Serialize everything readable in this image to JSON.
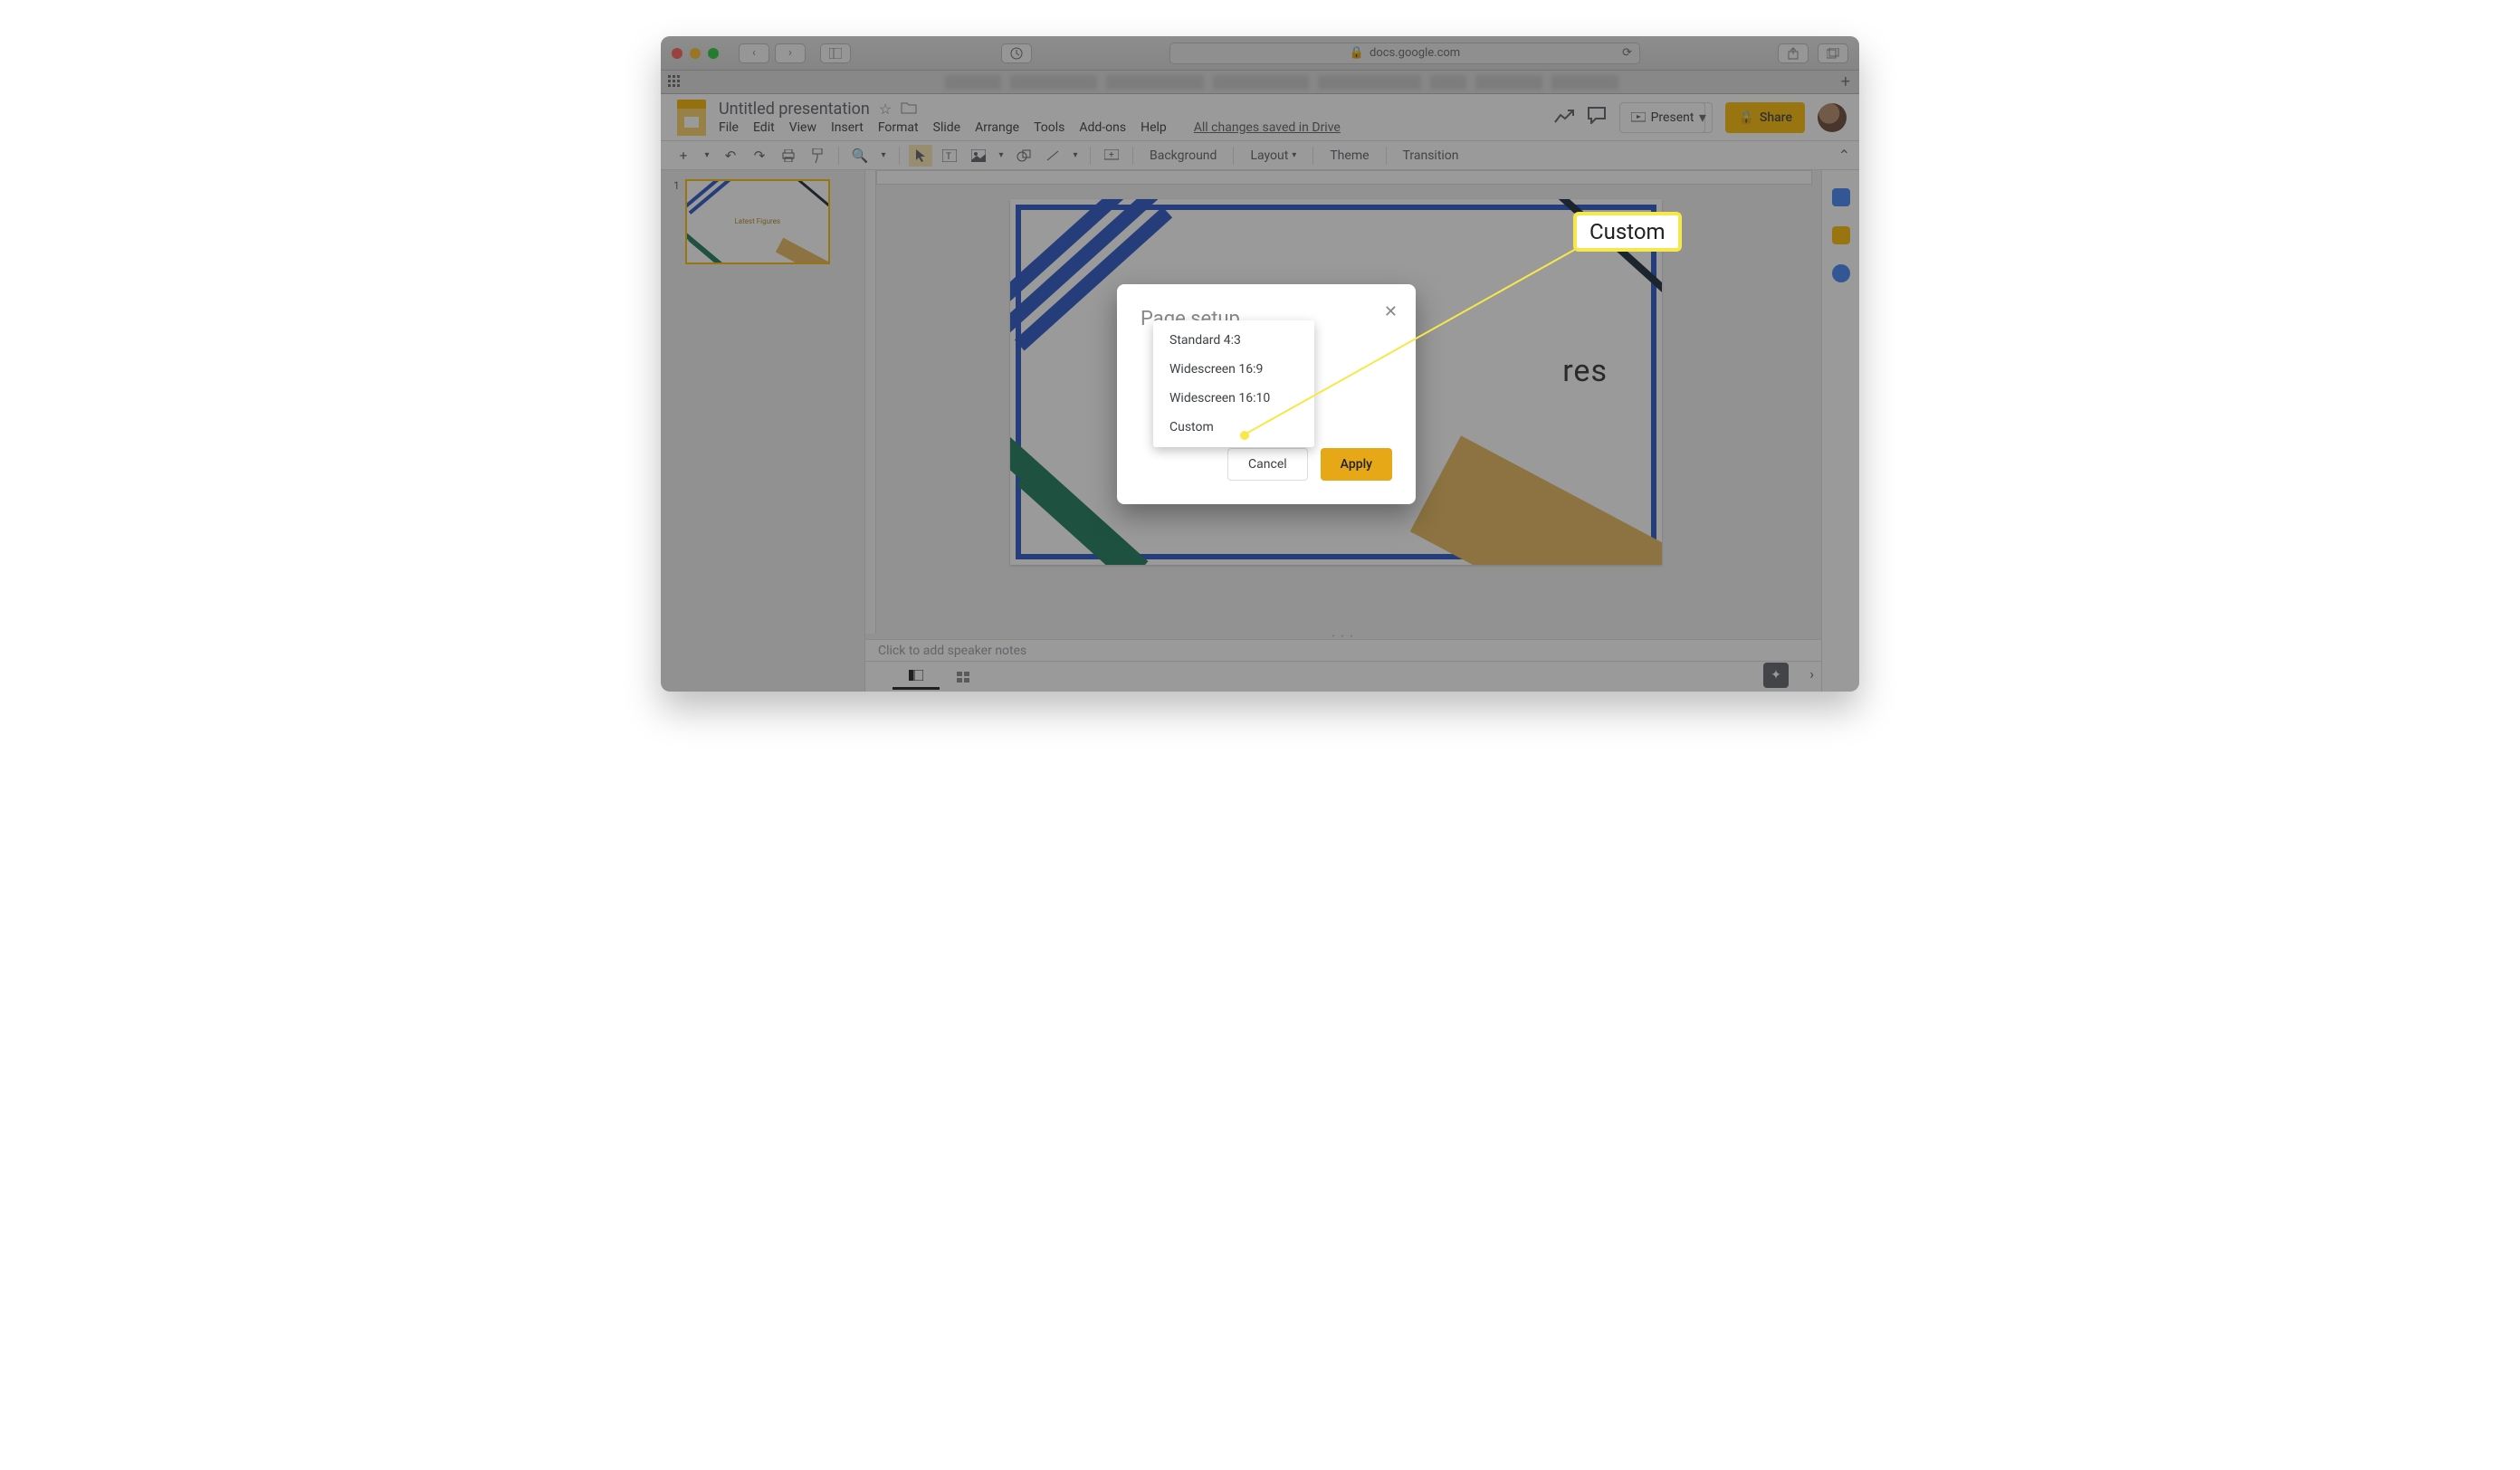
{
  "browser": {
    "url_host": "docs.google.com"
  },
  "document": {
    "title": "Untitled presentation",
    "saved_status": "All changes saved in Drive"
  },
  "menus": [
    "File",
    "Edit",
    "View",
    "Insert",
    "Format",
    "Slide",
    "Arrange",
    "Tools",
    "Add-ons",
    "Help"
  ],
  "toolbar": {
    "background": "Background",
    "layout": "Layout",
    "theme": "Theme",
    "transition": "Transition"
  },
  "actions": {
    "present": "Present",
    "share": "Share"
  },
  "thumb": {
    "number": "1",
    "title": "Latest Figures"
  },
  "slide": {
    "headline": "res"
  },
  "notes_placeholder": "Click to add speaker notes",
  "dialog": {
    "title": "Page setup",
    "options": [
      "Standard 4:3",
      "Widescreen 16:9",
      "Widescreen 16:10",
      "Custom"
    ],
    "cancel": "Cancel",
    "apply": "Apply"
  },
  "callout": {
    "label": "Custom"
  }
}
